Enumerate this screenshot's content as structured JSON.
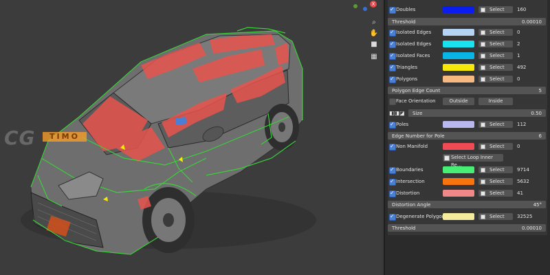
{
  "watermark": {
    "text": "CG",
    "sub": "TIMO"
  },
  "panel": {
    "rows": [
      {
        "label": "Doubles",
        "color": "#0b1cf0",
        "select": "Select",
        "value": "160",
        "checked": true
      },
      {
        "label": "Isolated Edges",
        "color": "#b5d4f4",
        "select": "Select",
        "value": "0",
        "checked": true
      },
      {
        "label": "Isolated Edges",
        "color": "#19e2f0",
        "select": "Select",
        "value": "2",
        "checked": true
      },
      {
        "label": "Isolated Faces",
        "color": "#08b5e6",
        "select": "Select",
        "value": "1",
        "checked": true
      },
      {
        "label": "Triangles",
        "color": "#f7e80c",
        "select": "Select",
        "value": "492",
        "checked": true
      },
      {
        "label": "Polygons",
        "color": "#f8b980",
        "select": "Select",
        "value": "0",
        "checked": true
      },
      {
        "label": "Poles",
        "color": "#b8b8ee",
        "select": "Select",
        "value": "112",
        "checked": true
      },
      {
        "label": "Non Manifold",
        "color": "#f04a55",
        "select": "Select",
        "value": "0",
        "checked": true
      },
      {
        "label": "Boundaries",
        "color": "#46ef73",
        "select": "Select",
        "value": "9714",
        "checked": true
      },
      {
        "label": "Intersection",
        "color": "#f6730d",
        "select": "Select",
        "value": "5632",
        "checked": true
      },
      {
        "label": "Distortion",
        "color": "#f08888",
        "select": "Select",
        "value": "41",
        "checked": true
      },
      {
        "label": "Degenerate Polygons",
        "color": "#f4ec9c",
        "select": "Select",
        "value": "32525",
        "checked": true
      }
    ],
    "threshold1": {
      "label": "Threshold",
      "value": "0.00010"
    },
    "polygon_edge_count": {
      "label": "Polygon Edge Count",
      "value": "5"
    },
    "face_orientation": {
      "label": "Face Orientation",
      "outside": "Outside",
      "inside": "Inside",
      "checked": false
    },
    "size": {
      "label": "Size",
      "value": "0.50"
    },
    "edge_number_for_pole": {
      "label": "Edge Number for Pole",
      "value": "6"
    },
    "select_loop": {
      "label": "Select Loop Inner Re..."
    },
    "distortion_angle": {
      "label": "Distortion Angle",
      "value": "45°"
    },
    "threshold2": {
      "label": "Threshold",
      "value": "0.00010"
    }
  },
  "icons": {
    "zoom": "magnifier-icon",
    "pan": "hand-icon",
    "camera": "camera-icon",
    "grid": "grid-icon",
    "gizmo_x": "x-axis-icon"
  },
  "colors": {
    "accent": "#4a7fd6",
    "wire_green": "#3ad13a",
    "wire_red": "#e8544e"
  }
}
